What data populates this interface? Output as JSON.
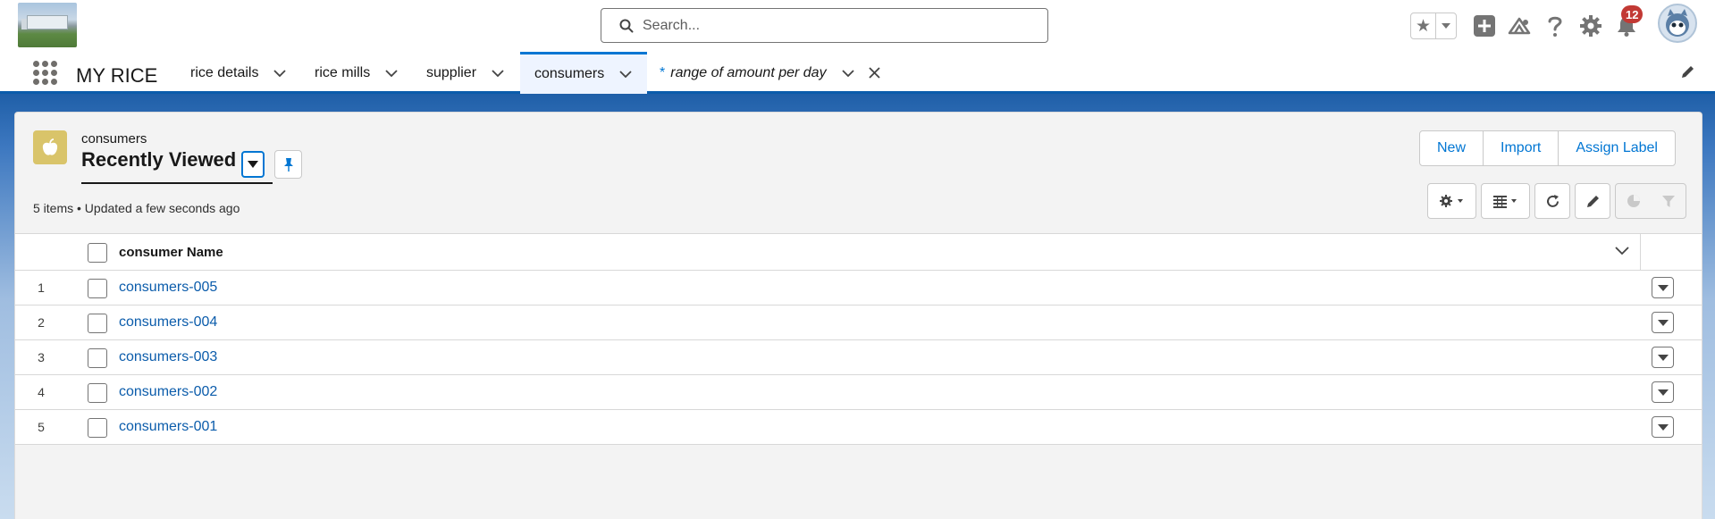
{
  "header": {
    "search_placeholder": "Search...",
    "notification_count": "12",
    "icons": [
      "favorites-star-icon",
      "global-actions-plus-icon",
      "trailhead-icon",
      "help-icon",
      "setup-gear-icon",
      "notifications-bell-icon"
    ]
  },
  "nav": {
    "app_name": "MY RICE",
    "tabs": [
      {
        "label": "rice details"
      },
      {
        "label": "rice mills"
      },
      {
        "label": "supplier"
      },
      {
        "label": "consumers"
      },
      {
        "prefix": "*",
        "label": "range of amount per day"
      }
    ]
  },
  "list": {
    "object_name": "consumers",
    "view_name": "Recently Viewed",
    "meta": "5 items • Updated a few seconds ago",
    "actions": [
      "New",
      "Import",
      "Assign Label"
    ],
    "column_header": "consumer Name",
    "rows": [
      {
        "num": "1",
        "name": "consumers-005"
      },
      {
        "num": "2",
        "name": "consumers-004"
      },
      {
        "num": "3",
        "name": "consumers-003"
      },
      {
        "num": "4",
        "name": "consumers-002"
      },
      {
        "num": "5",
        "name": "consumers-001"
      }
    ]
  },
  "colors": {
    "brand_blue": "#0176d3",
    "nav_underline": "#0b5cab",
    "object_icon": "#d9c46a",
    "badge": "#c23934"
  }
}
